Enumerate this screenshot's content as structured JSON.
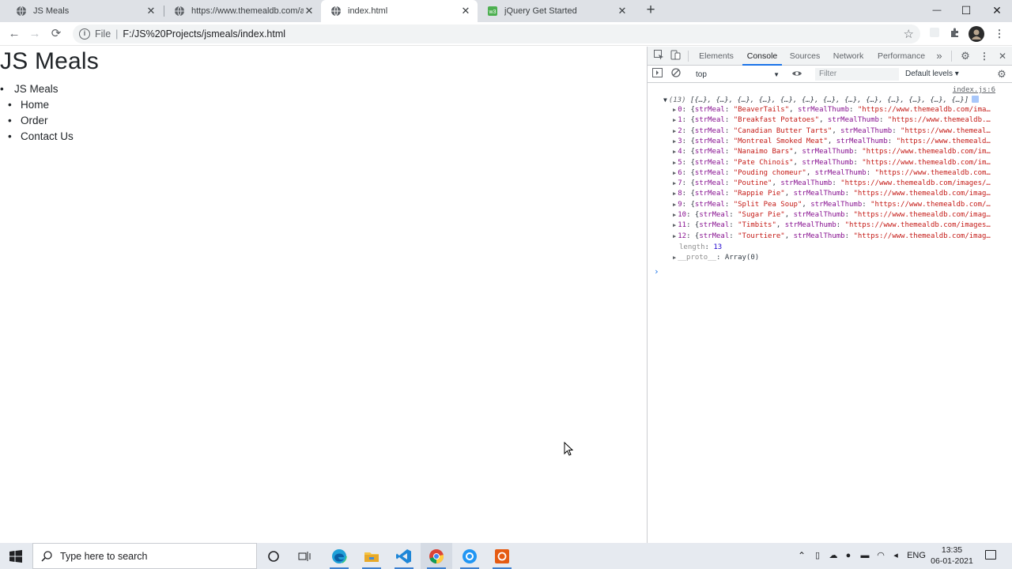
{
  "browser": {
    "tabs": [
      {
        "title": "JS Meals",
        "active": false
      },
      {
        "title": "https://www.themealdb.com/ap",
        "active": false
      },
      {
        "title": "index.html",
        "active": true
      },
      {
        "title": "jQuery Get Started",
        "active": false
      }
    ],
    "new_tab": "+",
    "window_controls": {
      "minimize": "—",
      "maximize": "☐",
      "close": "✕"
    },
    "nav": {
      "back": "←",
      "forward": "→",
      "reload": "⟳"
    },
    "address": {
      "scheme": "File",
      "divider": "|",
      "url": "F:/JS%20Projects/jsmeals/index.html"
    }
  },
  "page": {
    "heading": "JS Meals",
    "brand": "JS Meals",
    "links": [
      "Home",
      "Order",
      "Contact Us"
    ]
  },
  "devtools": {
    "tabs": [
      "Elements",
      "Console",
      "Sources",
      "Network",
      "Performance"
    ],
    "active_tab": "Console",
    "more_tabs": "»",
    "context": "top",
    "filter_placeholder": "Filter",
    "levels": "Default levels ▾",
    "source_link": "index.js:6",
    "array_count": "(13)",
    "array_preview": "[{…}, {…}, {…}, {…}, {…}, {…}, {…}, {…}, {…}, {…}, {…}, {…}, {…}]",
    "entries": [
      {
        "index": "0",
        "meal": "\"BeaverTails\"",
        "thumb": "\"https://www.themealdb.com/ima…"
      },
      {
        "index": "1",
        "meal": "\"Breakfast Potatoes\"",
        "thumb": "\"https://www.themealdb.…"
      },
      {
        "index": "2",
        "meal": "\"Canadian Butter Tarts\"",
        "thumb": "\"https://www.themeal…"
      },
      {
        "index": "3",
        "meal": "\"Montreal Smoked Meat\"",
        "thumb": "\"https://www.themeald…"
      },
      {
        "index": "4",
        "meal": "\"Nanaimo Bars\"",
        "thumb": "\"https://www.themealdb.com/im…"
      },
      {
        "index": "5",
        "meal": "\"Pate Chinois\"",
        "thumb": "\"https://www.themealdb.com/im…"
      },
      {
        "index": "6",
        "meal": "\"Pouding chomeur\"",
        "thumb": "\"https://www.themealdb.com…"
      },
      {
        "index": "7",
        "meal": "\"Poutine\"",
        "thumb": "\"https://www.themealdb.com/images/…"
      },
      {
        "index": "8",
        "meal": "\"Rappie Pie\"",
        "thumb": "\"https://www.themealdb.com/imag…"
      },
      {
        "index": "9",
        "meal": "\"Split Pea Soup\"",
        "thumb": "\"https://www.themealdb.com/…"
      },
      {
        "index": "10",
        "meal": "\"Sugar Pie\"",
        "thumb": "\"https://www.themealdb.com/imag…"
      },
      {
        "index": "11",
        "meal": "\"Timbits\"",
        "thumb": "\"https://www.themealdb.com/images…"
      },
      {
        "index": "12",
        "meal": "\"Tourtiere\"",
        "thumb": "\"https://www.themealdb.com/imag…"
      }
    ],
    "key_meal": "strMeal",
    "key_thumb": "strMealThumb",
    "length_key": "length",
    "length_value": "13",
    "proto_key": "__proto__",
    "proto_value": "Array(0)"
  },
  "taskbar": {
    "search_placeholder": "Type here to search",
    "language": "ENG",
    "time": "13:35",
    "date": "06-01-2021"
  },
  "colors": {
    "accent": "#1a73e8",
    "string": "#c41a16",
    "key": "#881391"
  }
}
